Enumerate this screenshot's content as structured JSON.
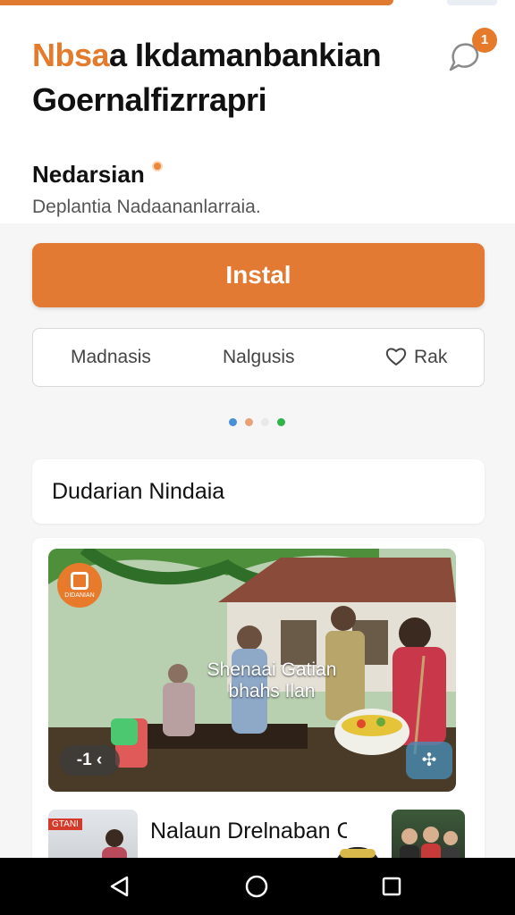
{
  "header": {
    "title_accent": "Nbsa",
    "title_rest": "a Ikdamanbankian",
    "title_line2": "Goernalfizrrapri",
    "notification_count": "1"
  },
  "app": {
    "name": "Nedarsian",
    "subtitle": "Deplantia Nadaananlarraia.",
    "install_label": "Instal"
  },
  "actions": {
    "items": [
      "Madnasis",
      "Nalgusis",
      "Rak"
    ]
  },
  "pager": {
    "dot_colors": [
      "#4a90d9",
      "#e8a27a",
      "#e8e8e8",
      "#2fb34a"
    ]
  },
  "section": {
    "title": "Dudarian Nindaia"
  },
  "media": {
    "logo_text": "DIDANIAN",
    "caption": "Shenaai Gatian bhahs Ilan",
    "pill_label": "-1 ‹",
    "item_title": "Nalaun Drelnaban Cornulimr D",
    "thumb_label": "GTANI"
  },
  "colors": {
    "accent": "#e27a33",
    "badge": "#e57a2b"
  }
}
